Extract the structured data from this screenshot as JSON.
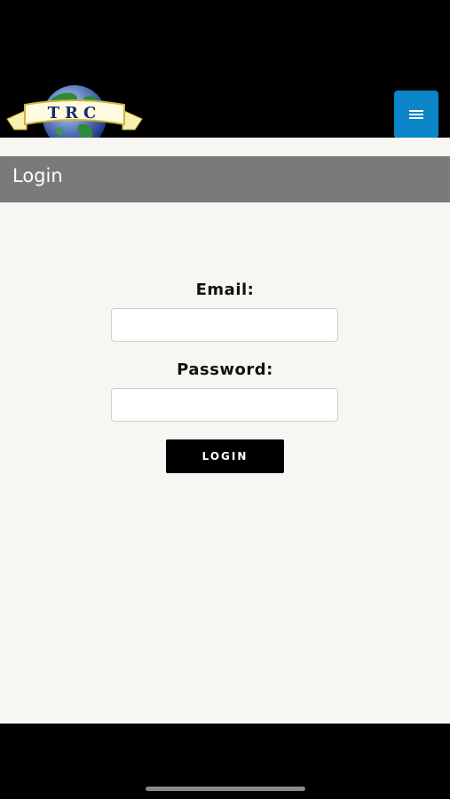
{
  "header": {
    "logo_text": "TRC",
    "menu_icon": "hamburger-icon",
    "menu_color": "#0a86c8"
  },
  "page": {
    "title": "Login"
  },
  "form": {
    "email_label": "Email:",
    "email_value": "",
    "password_label": "Password:",
    "password_value": "",
    "login_button": "LOGIN"
  },
  "colors": {
    "title_bar": "#7a7a7a",
    "background": "#f7f6f3",
    "button": "#000000"
  }
}
